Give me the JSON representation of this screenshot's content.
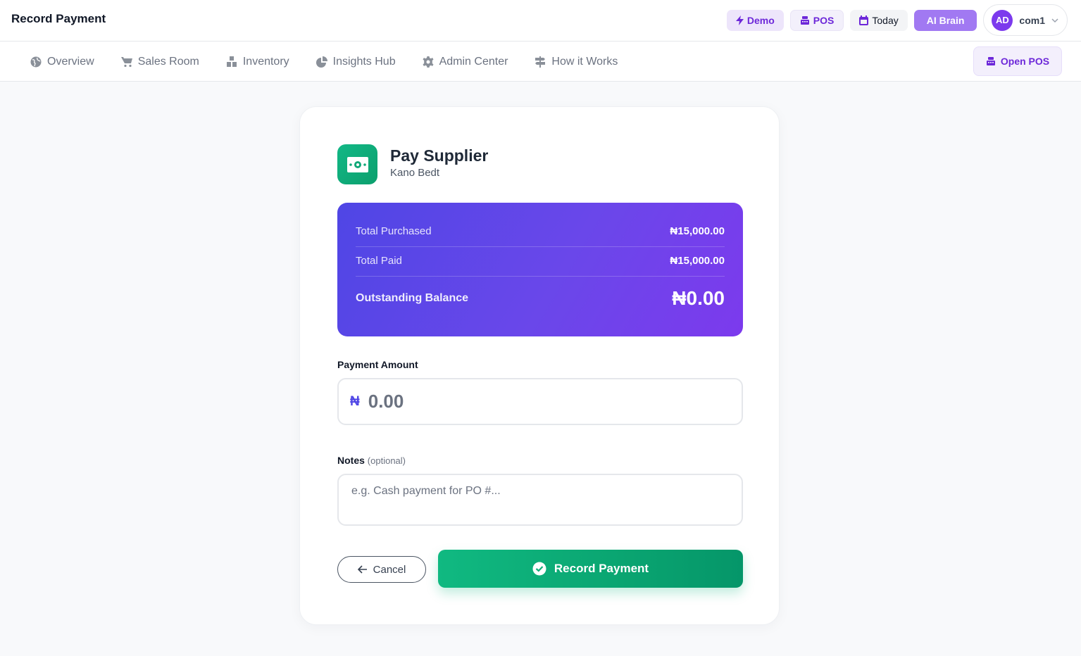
{
  "topbar": {
    "title": "Record Payment",
    "demo_label": "Demo",
    "pos_label": "POS",
    "today_label": "Today",
    "ai_label": "AI Brain",
    "avatar_initials": "AD",
    "user_name": "com1"
  },
  "nav": {
    "items": [
      {
        "label": "Overview",
        "icon": "globe-icon"
      },
      {
        "label": "Sales Room",
        "icon": "cart-icon"
      },
      {
        "label": "Inventory",
        "icon": "boxes-icon"
      },
      {
        "label": "Insights Hub",
        "icon": "pie-chart-icon"
      },
      {
        "label": "Admin Center",
        "icon": "gear-icon"
      },
      {
        "label": "How it Works",
        "icon": "signpost-icon"
      }
    ],
    "open_pos_label": "Open POS"
  },
  "card": {
    "title": "Pay Supplier",
    "subtitle": "Kano Bedt",
    "summary": {
      "total_purchased_label": "Total Purchased",
      "total_purchased_value": "₦15,000.00",
      "total_paid_label": "Total Paid",
      "total_paid_value": "₦15,000.00",
      "outstanding_label": "Outstanding Balance",
      "outstanding_value": "₦0.00"
    },
    "amount": {
      "label": "Payment Amount",
      "currency_symbol": "₦",
      "placeholder": "0.00",
      "value": ""
    },
    "notes": {
      "label": "Notes",
      "optional_label": "(optional)",
      "placeholder": "e.g. Cash payment for PO #...",
      "value": ""
    },
    "cancel_label": "Cancel",
    "record_label": "Record Payment"
  },
  "colors": {
    "accent": "#7c3aed",
    "primary_gradient_start": "#4f46e5",
    "success": "#10b981"
  }
}
